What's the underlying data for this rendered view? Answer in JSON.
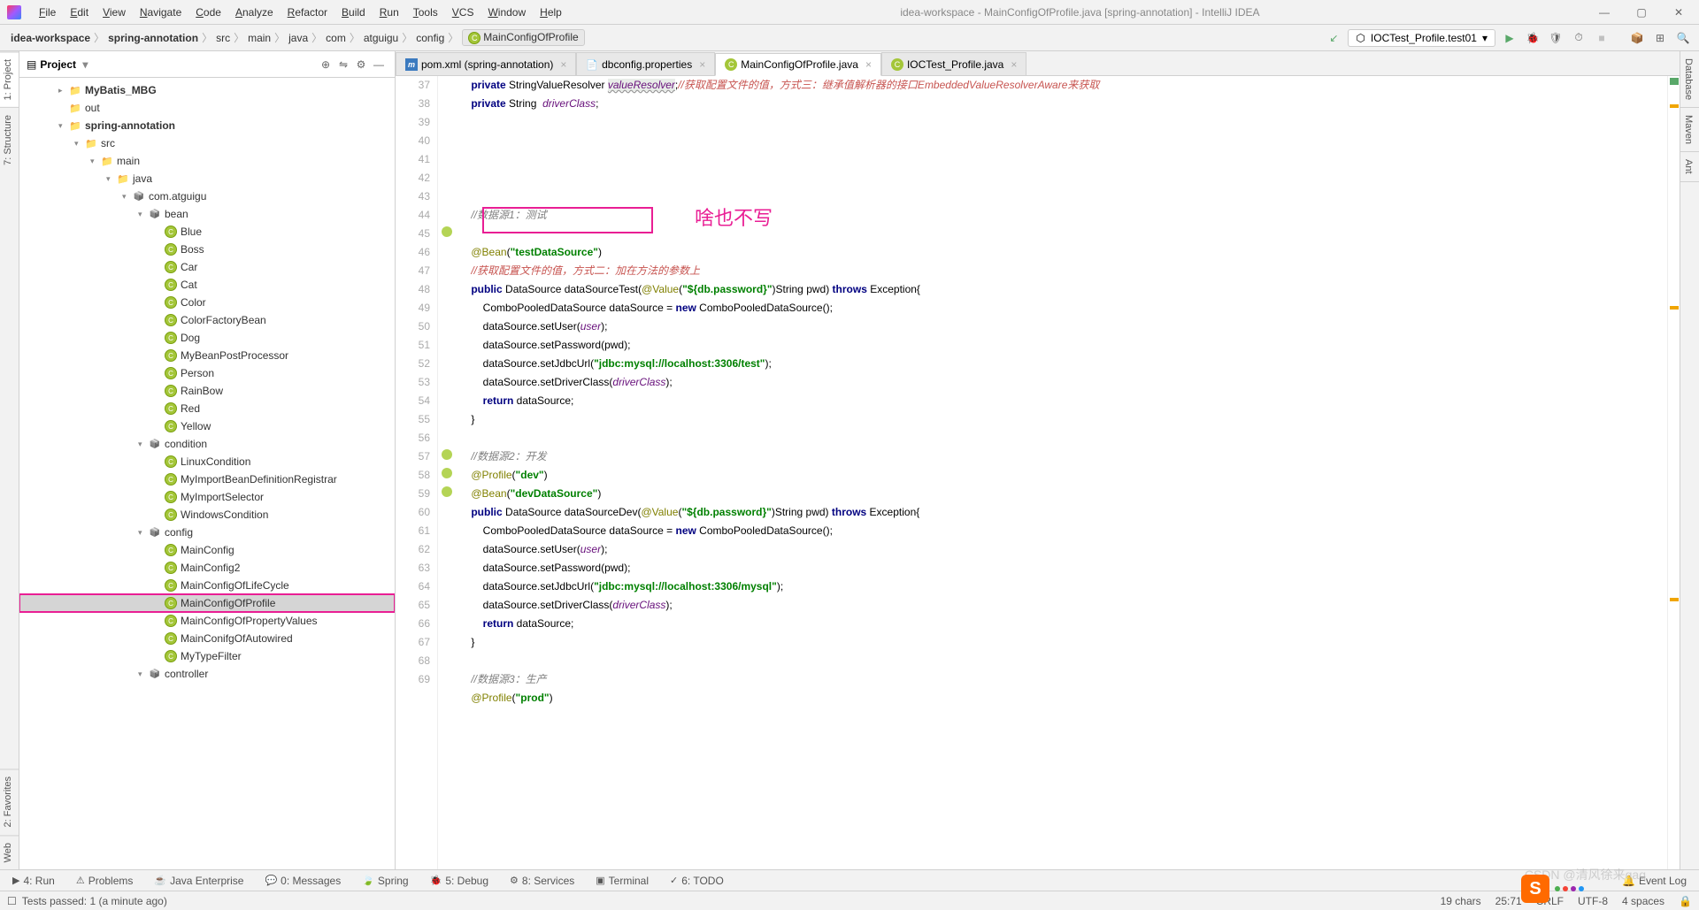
{
  "menu": [
    "File",
    "Edit",
    "View",
    "Navigate",
    "Code",
    "Analyze",
    "Refactor",
    "Build",
    "Run",
    "Tools",
    "VCS",
    "Window",
    "Help"
  ],
  "title": "idea-workspace - MainConfigOfProfile.java [spring-annotation] - IntelliJ IDEA",
  "breadcrumb": [
    "idea-workspace",
    "spring-annotation",
    "src",
    "main",
    "java",
    "com",
    "atguigu",
    "config"
  ],
  "breadcrumb_class": "MainConfigOfProfile",
  "run_config": "IOCTest_Profile.test01",
  "project_panel_title": "Project",
  "tree": {
    "items": [
      {
        "indent": 2,
        "arrow": "▸",
        "type": "folder",
        "label": "MyBatis_MBG",
        "bold": true
      },
      {
        "indent": 2,
        "arrow": "",
        "type": "folder",
        "label": "out"
      },
      {
        "indent": 2,
        "arrow": "▾",
        "type": "folder",
        "label": "spring-annotation",
        "bold": true
      },
      {
        "indent": 3,
        "arrow": "▾",
        "type": "folder",
        "label": "src"
      },
      {
        "indent": 4,
        "arrow": "▾",
        "type": "folder",
        "label": "main"
      },
      {
        "indent": 5,
        "arrow": "▾",
        "type": "folder",
        "label": "java"
      },
      {
        "indent": 6,
        "arrow": "▾",
        "type": "pkg",
        "label": "com.atguigu"
      },
      {
        "indent": 7,
        "arrow": "▾",
        "type": "pkg",
        "label": "bean"
      },
      {
        "indent": 8,
        "arrow": "",
        "type": "class",
        "label": "Blue"
      },
      {
        "indent": 8,
        "arrow": "",
        "type": "class",
        "label": "Boss"
      },
      {
        "indent": 8,
        "arrow": "",
        "type": "class",
        "label": "Car"
      },
      {
        "indent": 8,
        "arrow": "",
        "type": "class",
        "label": "Cat"
      },
      {
        "indent": 8,
        "arrow": "",
        "type": "class",
        "label": "Color"
      },
      {
        "indent": 8,
        "arrow": "",
        "type": "class",
        "label": "ColorFactoryBean"
      },
      {
        "indent": 8,
        "arrow": "",
        "type": "class",
        "label": "Dog"
      },
      {
        "indent": 8,
        "arrow": "",
        "type": "class",
        "label": "MyBeanPostProcessor"
      },
      {
        "indent": 8,
        "arrow": "",
        "type": "class",
        "label": "Person"
      },
      {
        "indent": 8,
        "arrow": "",
        "type": "class",
        "label": "RainBow"
      },
      {
        "indent": 8,
        "arrow": "",
        "type": "class",
        "label": "Red"
      },
      {
        "indent": 8,
        "arrow": "",
        "type": "class",
        "label": "Yellow"
      },
      {
        "indent": 7,
        "arrow": "▾",
        "type": "pkg",
        "label": "condition"
      },
      {
        "indent": 8,
        "arrow": "",
        "type": "class",
        "label": "LinuxCondition"
      },
      {
        "indent": 8,
        "arrow": "",
        "type": "class",
        "label": "MyImportBeanDefinitionRegistrar"
      },
      {
        "indent": 8,
        "arrow": "",
        "type": "class",
        "label": "MyImportSelector"
      },
      {
        "indent": 8,
        "arrow": "",
        "type": "class",
        "label": "WindowsCondition"
      },
      {
        "indent": 7,
        "arrow": "▾",
        "type": "pkg",
        "label": "config"
      },
      {
        "indent": 8,
        "arrow": "",
        "type": "class",
        "label": "MainConfig"
      },
      {
        "indent": 8,
        "arrow": "",
        "type": "class",
        "label": "MainConfig2"
      },
      {
        "indent": 8,
        "arrow": "",
        "type": "class",
        "label": "MainConfigOfLifeCycle"
      },
      {
        "indent": 8,
        "arrow": "",
        "type": "class",
        "label": "MainConfigOfProfile",
        "selected": true,
        "highlighted": true
      },
      {
        "indent": 8,
        "arrow": "",
        "type": "class",
        "label": "MainConfigOfPropertyValues"
      },
      {
        "indent": 8,
        "arrow": "",
        "type": "class",
        "label": "MainConifgOfAutowired"
      },
      {
        "indent": 8,
        "arrow": "",
        "type": "class",
        "label": "MyTypeFilter"
      },
      {
        "indent": 7,
        "arrow": "▾",
        "type": "pkg",
        "label": "controller"
      }
    ]
  },
  "tabs": [
    {
      "icon": "m",
      "label": "pom.xml (spring-annotation)",
      "active": false
    },
    {
      "icon": "p",
      "label": "dbconfig.properties",
      "active": false
    },
    {
      "icon": "c",
      "label": "MainConfigOfProfile.java",
      "active": true
    },
    {
      "icon": "c",
      "label": "IOCTest_Profile.java",
      "active": false
    }
  ],
  "line_start": 37,
  "line_end": 69,
  "annotation_text": "啥也不写",
  "bottom_tabs": [
    {
      "icon": "▶",
      "label": "4: Run"
    },
    {
      "icon": "⚠",
      "label": "Problems"
    },
    {
      "icon": "☕",
      "label": "Java Enterprise"
    },
    {
      "icon": "💬",
      "label": "0: Messages"
    },
    {
      "icon": "🍃",
      "label": "Spring"
    },
    {
      "icon": "🐞",
      "label": "5: Debug"
    },
    {
      "icon": "⚙",
      "label": "8: Services"
    },
    {
      "icon": "▣",
      "label": "Terminal"
    },
    {
      "icon": "✓",
      "label": "6: TODO"
    }
  ],
  "status": {
    "message": "Tests passed: 1 (a minute ago)",
    "chars": "19 chars",
    "pos": "25:71",
    "sep": "CRLF",
    "enc": "UTF-8",
    "indent": "4 spaces",
    "event_log": "Event Log"
  },
  "side_tabs_left": [
    "1: Project",
    "7: Structure",
    "2: Favorites",
    "Web"
  ],
  "side_tabs_right": [
    "Database",
    "Maven",
    "Ant"
  ],
  "watermark": "CSDN @清风徐来qaq"
}
